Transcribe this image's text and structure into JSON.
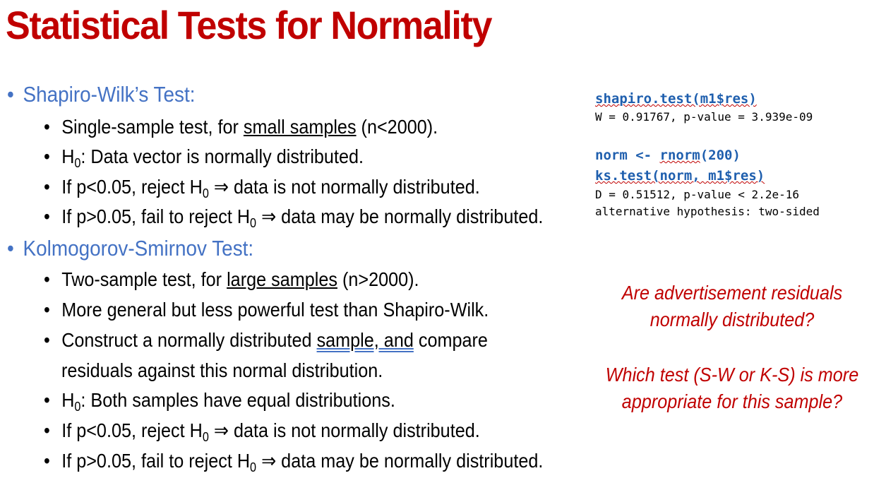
{
  "title": "Statistical Tests for Normality",
  "sections": [
    {
      "heading": "Shapiro-Wilk’s Test:",
      "items": [
        {
          "pre": "Single-sample test, for ",
          "u": "small samples",
          "post": " (n<2000)."
        },
        {
          "pre": "H",
          "sub": "0",
          "post": ": Data vector is normally distributed."
        },
        {
          "pre": "If p<0.05, reject H",
          "sub": "0",
          "post": " ⇒ data is not normally distributed."
        },
        {
          "pre": "If p>0.05, fail to reject H",
          "sub": "0",
          "post": " ⇒ data may be normally distributed."
        }
      ]
    },
    {
      "heading": "Kolmogorov-Smirnov Test:",
      "items": [
        {
          "pre": "Two-sample test, for ",
          "u": "large samples",
          "post": " (n>2000)."
        },
        {
          "pre": "More general but less powerful test than Shapiro-Wilk."
        },
        {
          "pre": "Construct a normally distributed ",
          "u": "sample, and",
          "post": " compare",
          "cont": "residuals against this normal distribution."
        },
        {
          "pre": "H",
          "sub": "0",
          "post": ": Both samples have equal distributions."
        },
        {
          "pre": "If p<0.05, reject H",
          "sub": "0",
          "post": " ⇒ data is not normally distributed."
        },
        {
          "pre": "If p>0.05, fail to reject H",
          "sub": "0",
          "post": " ⇒ data may be normally distributed."
        }
      ]
    }
  ],
  "code": {
    "cmd1": "shapiro.test(m1$res)",
    "out1": "W = 0.91767, p-value = 3.939e-09",
    "cmd2_a": "norm <- ",
    "cmd2_b": "rnorm",
    "cmd2_c": "(200)",
    "cmd3": "ks.test(norm, m1$res)",
    "out2": "D = 0.51512, p-value < 2.2e-16",
    "out3": "alternative hypothesis: two-sided"
  },
  "questions": {
    "q1_line1": "Are advertisement residuals",
    "q1_line2": "normally distributed?",
    "q2_line1": "Which test (S-W or K-S) is more",
    "q2_line2": "appropriate  for this sample?"
  },
  "colors": {
    "title": "#C00000",
    "heading": "#4472C4",
    "code_cmd": "#1F5FAE",
    "question": "#C00000"
  }
}
